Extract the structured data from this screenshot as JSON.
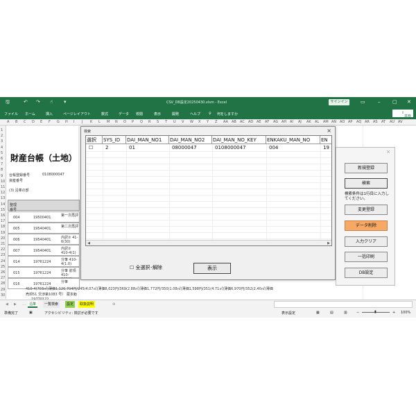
{
  "excel": {
    "file_title": "CSV_DB設定20250430.xlsm  -  Excel",
    "signin": "サインイン",
    "share": "共有",
    "ribbon_tabs": [
      "ファイル",
      "ホーム",
      "挿入",
      "ページレイアウト",
      "数式",
      "データ",
      "校閲",
      "表示",
      "開発",
      "ヘルプ",
      "何をしますか"
    ],
    "columns": [
      "A",
      "B",
      "C",
      "D",
      "E",
      "F",
      "G",
      "H",
      "I",
      "J",
      "K",
      "L",
      "M",
      "N",
      "O",
      "P",
      "Q",
      "R",
      "S",
      "T",
      "U",
      "V",
      "W",
      "X",
      "Y",
      "Z",
      "AA",
      "AB",
      "AC",
      "AD",
      "AE",
      "AF",
      "AG",
      "AH",
      "AI",
      "AJ",
      "AK",
      "AL",
      "AM",
      "AN",
      "AO",
      "AP",
      "AQ",
      "AR",
      "AS",
      "AT",
      "AU",
      "AV"
    ],
    "rows": [
      "1",
      "2",
      "3",
      "4",
      "5",
      "6",
      "7",
      "8",
      "9",
      "10",
      "11",
      "12",
      "13",
      "14",
      "15",
      "16",
      "17",
      "18",
      "19",
      "20",
      "21",
      "22",
      "23",
      "24",
      "25",
      "26",
      "27",
      "28",
      "29",
      "30"
    ]
  },
  "sheet": {
    "title": "財産台帳（土地）",
    "ledger_label": "台帳登録番号",
    "ledger_value": "0108000047",
    "asset_label": "資産番号",
    "section": "(3) 沿革の部",
    "col_no": "整理番号",
    "entries": [
      {
        "no": "004",
        "date": "19500401",
        "desc": "第一次再評"
      },
      {
        "no": "005",
        "date": "19540401",
        "desc": "第二次再評"
      },
      {
        "no": "006",
        "date": "19540401",
        "desc": "内訳②  41-6(30)"
      },
      {
        "no": "007",
        "date": "19540401",
        "desc": "内訳②  410-4(1)"
      },
      {
        "no": "014",
        "date": "19761224",
        "desc": "分筆  410-4(1.0)"
      },
      {
        "no": "015",
        "date": "19761224",
        "desc": "分筆  前項  410-342(3)"
      },
      {
        "no": "016",
        "date": "19761224",
        "desc": "分筆"
      }
    ],
    "bottom_text1": "410-4(703㎡)薄価1,120,704円/245/4,07㎡)薄価8,023円/369(2.88㎡)薄価1,772円/350(1.08㎡)薄価1,598円/351(4.71㎡)薄価6,970円/352(2.40㎡)薄価",
    "bottom_text2": "売却51 交渉第1083 号）  蔵本勅",
    "row30_date": "19770122"
  },
  "sheet_tabs": [
    "沿革",
    "一覧検索",
    "設定",
    "取扱説明"
  ],
  "status": {
    "ready": "準備完了",
    "accessibility": "アクセシビリティ: 検討が必要です",
    "display_settings": "表示設定",
    "zoom": "100%"
  },
  "dialog": {
    "title": "検索",
    "close": "×",
    "headers": [
      "選択",
      "SYS_ID",
      "DAI_MAN_NO1",
      "DAI_MAN_NO2",
      "DAI_MAN_NO_KEY",
      "ENKAKU_MAN_NO",
      "EN"
    ],
    "rows": [
      {
        "sel": "☐",
        "sys_id": "2",
        "no1": "01",
        "no2": "08000047",
        "key": "0108000047",
        "enkaku": "004",
        "en": "19"
      }
    ],
    "select_all": "全選択･解除",
    "show_button": "表示"
  },
  "panel": {
    "close": "×",
    "new_button": "新規登録",
    "search_button": "検索",
    "note": "検索条件は1行目に入力してください。",
    "update_button": "変更登録",
    "delete_button": "データ削除",
    "clear_button": "入力クリア",
    "print_button": "一括印刷",
    "db_button": "DB設定"
  }
}
